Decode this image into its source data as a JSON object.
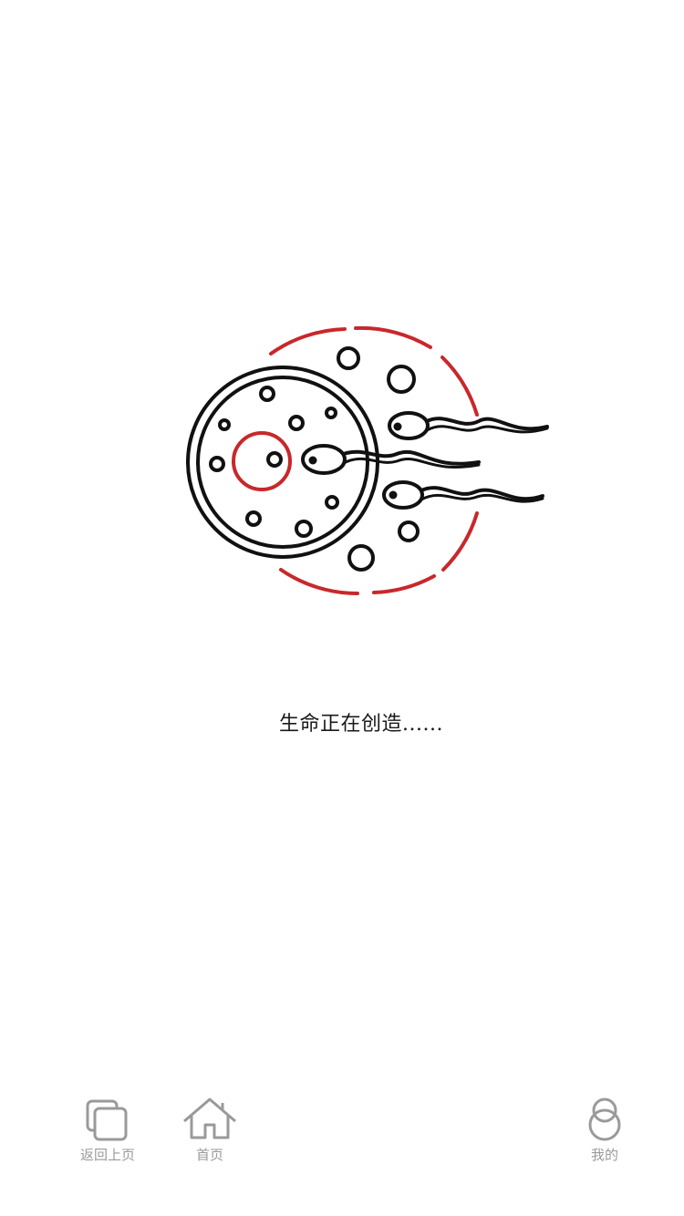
{
  "loading": {
    "message": "生命正在创造......"
  },
  "tabbar": {
    "items": [
      {
        "label": "返回上页",
        "icon": "back-pages-icon"
      },
      {
        "label": "首页",
        "icon": "home-icon"
      },
      {
        "label": "我的",
        "icon": "user-icon"
      }
    ]
  },
  "colors": {
    "accent_red": "#c8282b",
    "ink": "#111111",
    "tab_gray": "#9a9a9a"
  }
}
